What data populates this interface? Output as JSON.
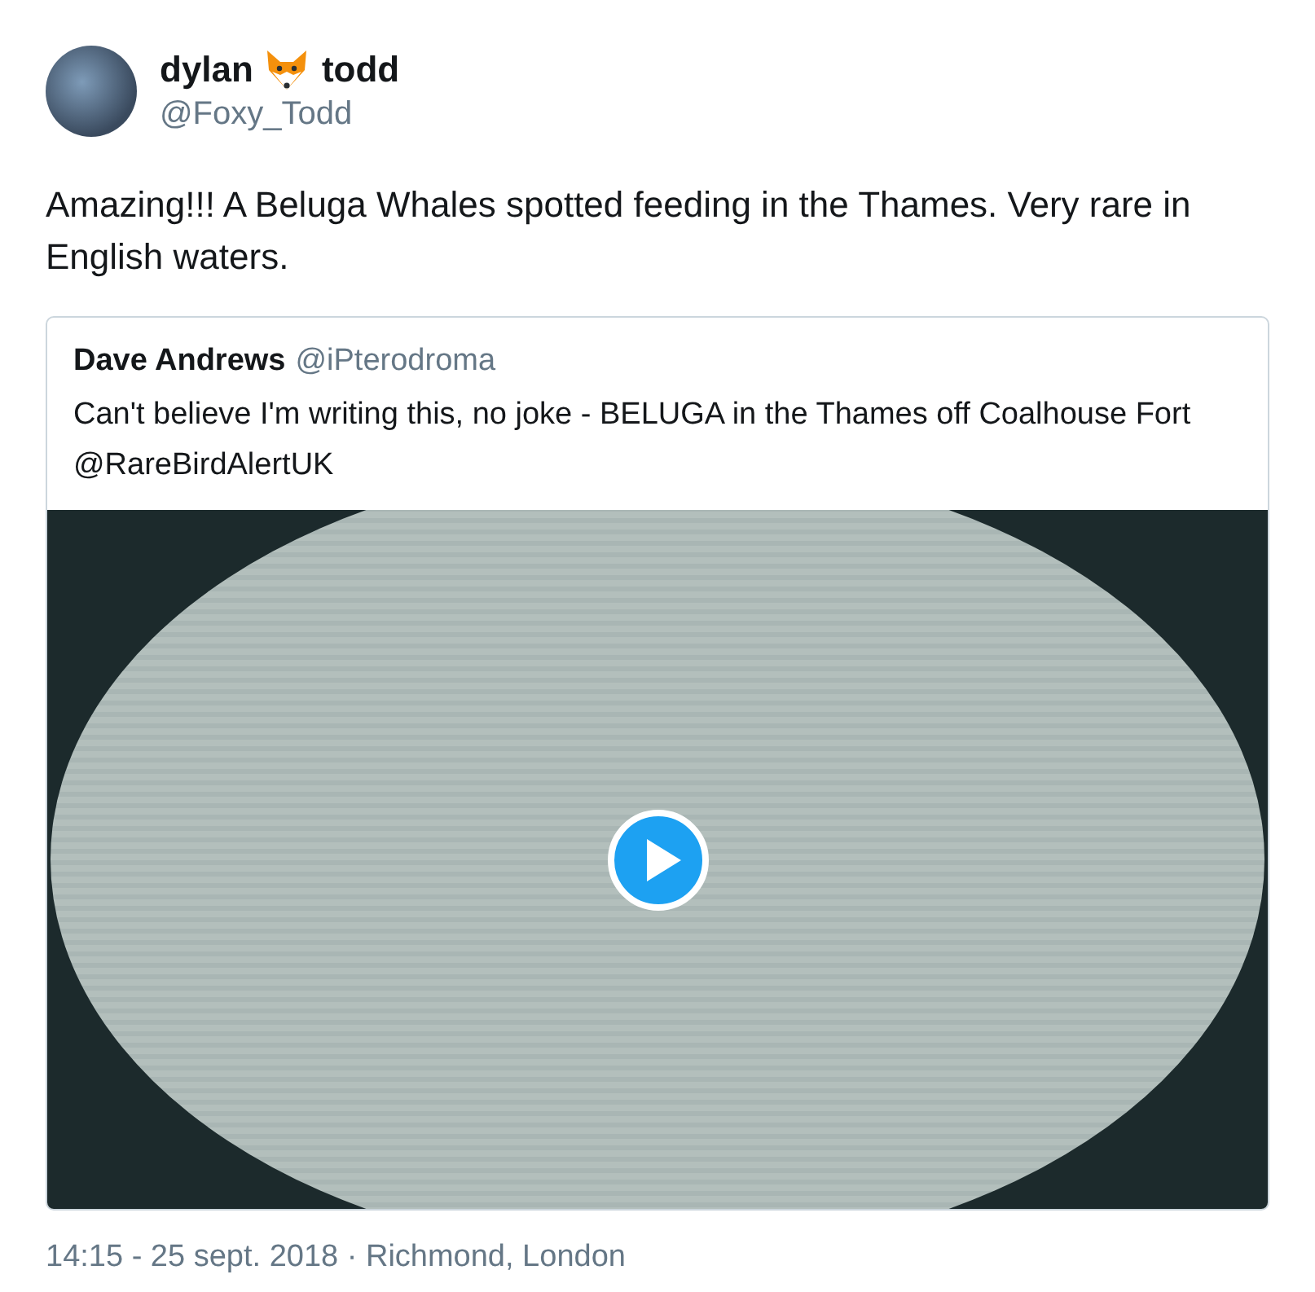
{
  "author": {
    "name_parts": [
      "dylan",
      "todd"
    ],
    "handle": "@Foxy_Todd"
  },
  "text": "Amazing!!! A Beluga Whales spotted feeding in the Thames. Very rare in English waters.",
  "quoted_tweet": {
    "name": "Dave Andrews",
    "handle": "@iPterodroma",
    "text": "Can't believe I'm writing this, no joke - BELUGA in the Thames off Coalhouse Fort @RareBirdAlertUK"
  },
  "footer": "14:15 - 25 sept. 2018 · Richmond, London"
}
